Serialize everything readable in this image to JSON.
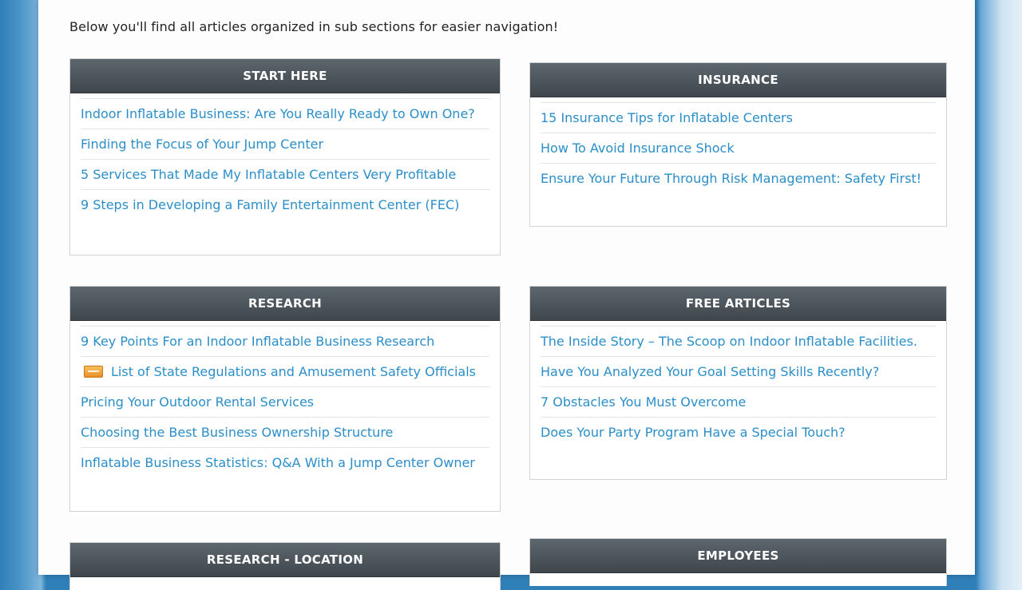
{
  "intro": "Below you'll find all articles organized in sub sections for easier navigation!",
  "sections": [
    {
      "title": "START HERE",
      "links": [
        "Indoor Inflatable Business: Are You Really Ready to Own One?",
        "Finding the Focus of Your Jump Center",
        "5 Services That Made My Inflatable Centers Very Profitable",
        "9 Steps in Developing a Family Entertainment Center (FEC)"
      ]
    },
    {
      "title": "INSURANCE",
      "links": [
        "15 Insurance Tips for Inflatable Centers",
        "How To Avoid Insurance Shock",
        "Ensure Your Future Through Risk Management: Safety First!"
      ]
    },
    {
      "title": "RESEARCH",
      "links": [
        "9 Key Points For an Indoor Inflatable Business Research",
        "List of State Regulations and Amusement Safety Officials",
        "Pricing Your Outdoor Rental Services",
        "Choosing the Best Business Ownership Structure",
        "Inflatable Business Statistics: Q&A With a Jump Center Owner"
      ]
    },
    {
      "title": "FREE ARTICLES",
      "links": [
        "The Inside Story – The Scoop on Indoor Inflatable Facilities.",
        "Have You Analyzed Your Goal Setting Skills Recently?",
        "7 Obstacles You Must Overcome",
        "Does Your Party Program Have a Special Touch?"
      ]
    },
    {
      "title": "RESEARCH - LOCATION",
      "links": []
    },
    {
      "title": "EMPLOYEES",
      "links": []
    }
  ],
  "icons": {
    "research_link_2": "pdf-icon"
  }
}
